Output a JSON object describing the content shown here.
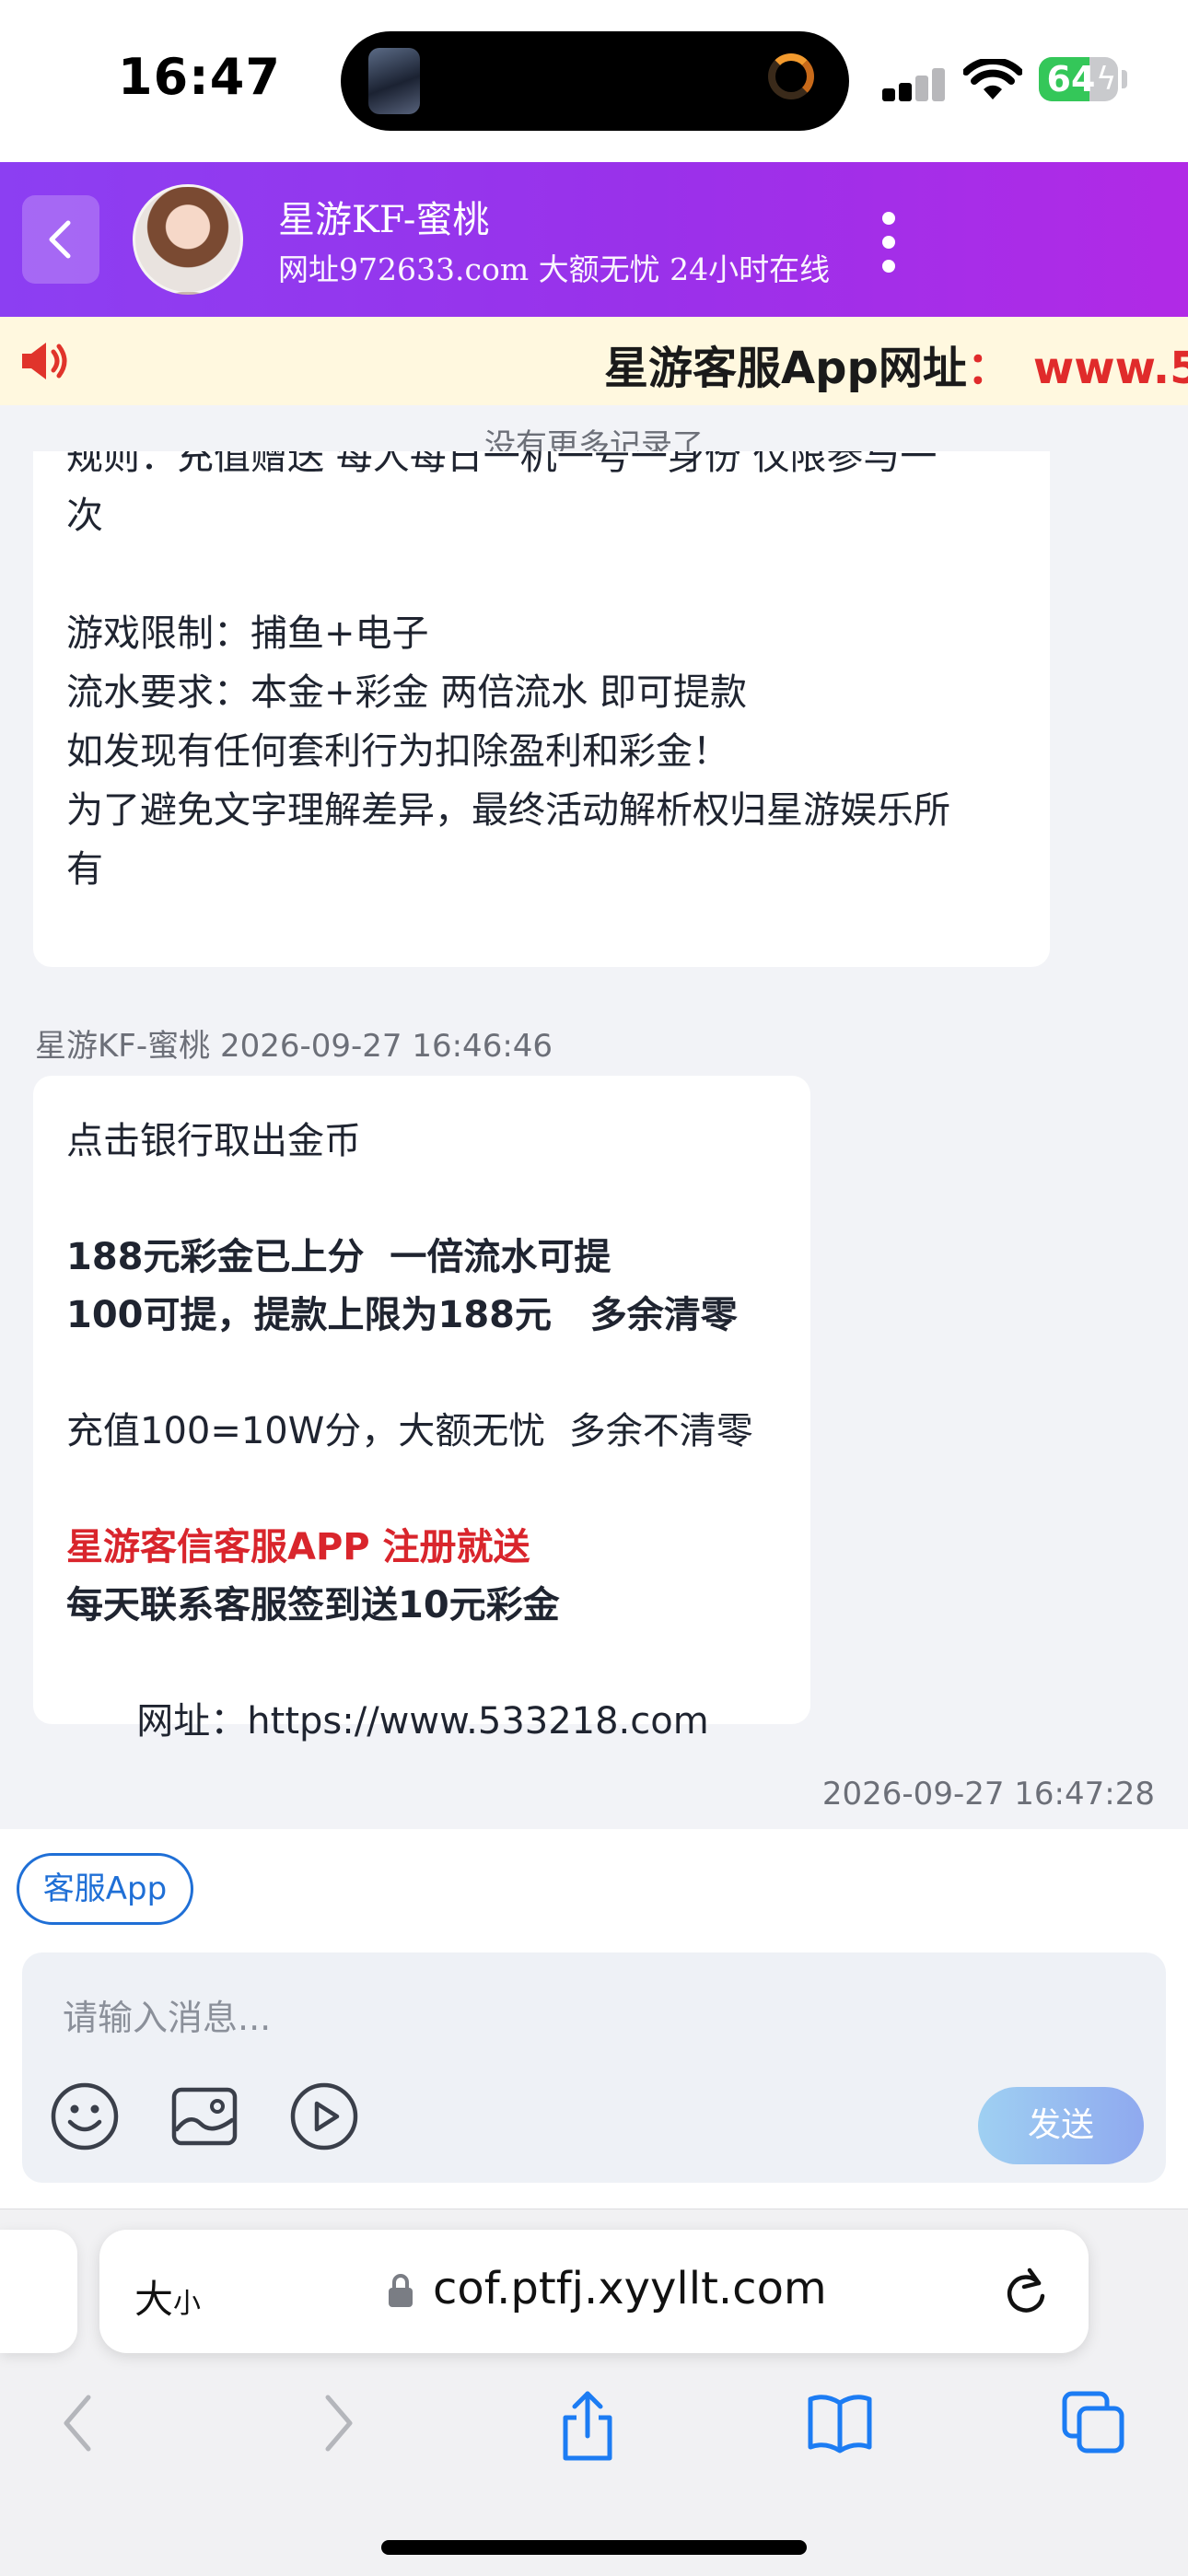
{
  "status_bar": {
    "time": "16:47",
    "battery": "64"
  },
  "header": {
    "agent_name": "星游KF-蜜桃",
    "subtitle": "网址972633.com 大额无忧 24小时在线",
    "accent_start": "#8c3ff2",
    "accent_end": "#b12ae6"
  },
  "marquee": {
    "text": "星游客服App网址",
    "colon": "：",
    "url_fragment": "www.5"
  },
  "chat": {
    "no_more_records": "没有更多记录了",
    "message1": {
      "lines": [
        "规则：充值赠送 每人每日一机一号一身份 仅限参与一",
        "次",
        "",
        "游戏限制：捕鱼+电子",
        "流水要求：本金+彩金 两倍流水 即可提款",
        "如发现有任何套利行为扣除盈利和彩金！",
        "为了避免文字理解差异，最终活动解析权归星游娱乐所",
        "有"
      ]
    },
    "message2": {
      "sender": "星游KF-蜜桃",
      "time": "2026-09-27 16:46:46",
      "line1": "点击银行取出金币",
      "line2": "188元彩金已上分  一倍流水可提",
      "line3": "100可提，提款上限为188元   多余清零",
      "line4": "充值100=10W分，大额无忧  多余不清零",
      "line5": "星游客信客服APP 注册就送",
      "line6": "每天联系客服签到送10元彩金",
      "line7_label": "网址：",
      "line7_url": "https://www.533218.com"
    },
    "last_timestamp": "2026-09-27 16:47:28"
  },
  "input": {
    "chip_label": "客服App",
    "placeholder": "请输入消息...",
    "send_label": "发送"
  },
  "browser": {
    "text_size_big": "大",
    "text_size_small": "小",
    "domain": "cof.ptfj.xyyllt.com"
  },
  "icons": {
    "back": "chevron-left-icon",
    "more": "more-vertical-icon",
    "speaker": "megaphone-icon",
    "emoji": "smile-icon",
    "image": "image-icon",
    "video": "play-icon"
  },
  "colors": {
    "link_blue": "#1f6fd6",
    "promo_red": "#d9252c",
    "battery_green": "#34c759"
  }
}
